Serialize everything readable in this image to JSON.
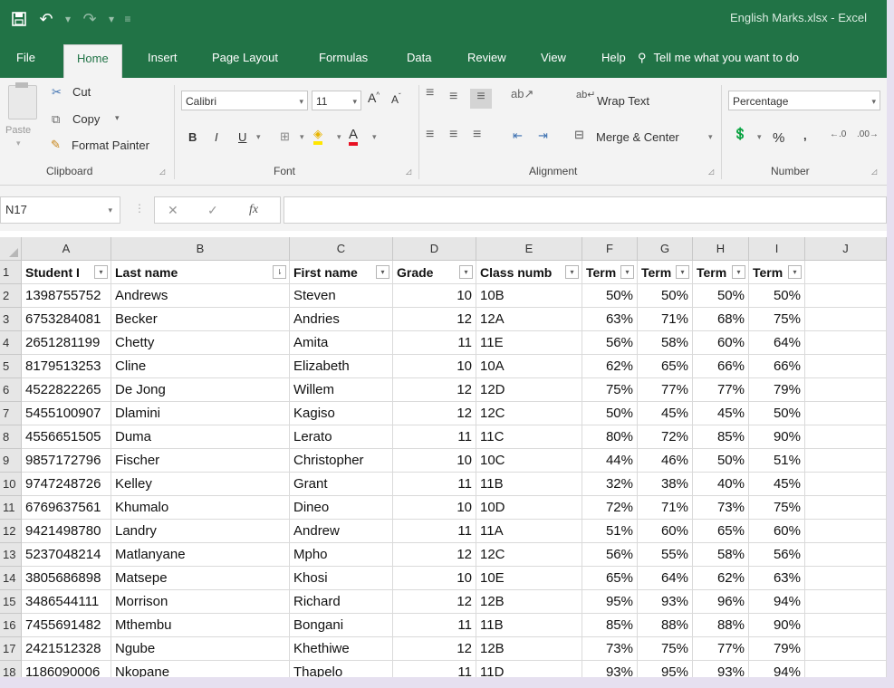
{
  "window": {
    "title": "English Marks.xlsx  -  Excel"
  },
  "qat": {
    "save_icon": "save-icon",
    "undo_icon": "undo-icon",
    "redo_icon": "redo-icon"
  },
  "tabs": [
    "File",
    "Home",
    "Insert",
    "Page Layout",
    "Formulas",
    "Data",
    "Review",
    "View",
    "Help"
  ],
  "tell_me": "Tell me what you want to do",
  "ribbon": {
    "clipboard": {
      "paste": "Paste",
      "cut": "Cut",
      "copy": "Copy",
      "format_painter": "Format Painter",
      "label": "Clipboard"
    },
    "font": {
      "name": "Calibri",
      "size": "11",
      "label": "Font"
    },
    "alignment": {
      "wrap_text": "Wrap Text",
      "merge_center": "Merge & Center",
      "label": "Alignment"
    },
    "number": {
      "format": "Percentage",
      "percent": "%",
      "comma": ",",
      "label": "Number"
    }
  },
  "formula_bar": {
    "name_box": "N17",
    "fx": "fx",
    "value": ""
  },
  "columns": [
    "A",
    "B",
    "C",
    "D",
    "E",
    "F",
    "G",
    "H",
    "I",
    "J"
  ],
  "header_row": [
    "Student I",
    "Last name",
    "First name",
    "Grade",
    "Class numb",
    "Term",
    "Term",
    "Term",
    "Term"
  ],
  "rows": [
    {
      "n": "2",
      "id": "1398755752",
      "last": "Andrews",
      "first": "Steven",
      "grade": "10",
      "cls": "10B",
      "t1": "50%",
      "t2": "50%",
      "t3": "50%",
      "t4": "50%"
    },
    {
      "n": "3",
      "id": "6753284081",
      "last": "Becker",
      "first": "Andries",
      "grade": "12",
      "cls": "12A",
      "t1": "63%",
      "t2": "71%",
      "t3": "68%",
      "t4": "75%"
    },
    {
      "n": "4",
      "id": "2651281199",
      "last": "Chetty",
      "first": "Amita",
      "grade": "11",
      "cls": "11E",
      "t1": "56%",
      "t2": "58%",
      "t3": "60%",
      "t4": "64%"
    },
    {
      "n": "5",
      "id": "8179513253",
      "last": "Cline",
      "first": "Elizabeth",
      "grade": "10",
      "cls": "10A",
      "t1": "62%",
      "t2": "65%",
      "t3": "66%",
      "t4": "66%"
    },
    {
      "n": "6",
      "id": "4522822265",
      "last": "De Jong",
      "first": "Willem",
      "grade": "12",
      "cls": "12D",
      "t1": "75%",
      "t2": "77%",
      "t3": "77%",
      "t4": "79%"
    },
    {
      "n": "7",
      "id": "5455100907",
      "last": "Dlamini",
      "first": "Kagiso",
      "grade": "12",
      "cls": "12C",
      "t1": "50%",
      "t2": "45%",
      "t3": "45%",
      "t4": "50%"
    },
    {
      "n": "8",
      "id": "4556651505",
      "last": "Duma",
      "first": "Lerato",
      "grade": "11",
      "cls": "11C",
      "t1": "80%",
      "t2": "72%",
      "t3": "85%",
      "t4": "90%"
    },
    {
      "n": "9",
      "id": "9857172796",
      "last": "Fischer",
      "first": "Christopher",
      "grade": "10",
      "cls": "10C",
      "t1": "44%",
      "t2": "46%",
      "t3": "50%",
      "t4": "51%"
    },
    {
      "n": "10",
      "id": "9747248726",
      "last": "Kelley",
      "first": "Grant",
      "grade": "11",
      "cls": "11B",
      "t1": "32%",
      "t2": "38%",
      "t3": "40%",
      "t4": "45%"
    },
    {
      "n": "11",
      "id": "6769637561",
      "last": "Khumalo",
      "first": "Dineo",
      "grade": "10",
      "cls": "10D",
      "t1": "72%",
      "t2": "71%",
      "t3": "73%",
      "t4": "75%"
    },
    {
      "n": "12",
      "id": "9421498780",
      "last": "Landry",
      "first": "Andrew",
      "grade": "11",
      "cls": "11A",
      "t1": "51%",
      "t2": "60%",
      "t3": "65%",
      "t4": "60%"
    },
    {
      "n": "13",
      "id": "5237048214",
      "last": "Matlanyane",
      "first": "Mpho",
      "grade": "12",
      "cls": "12C",
      "t1": "56%",
      "t2": "55%",
      "t3": "58%",
      "t4": "56%"
    },
    {
      "n": "14",
      "id": "3805686898",
      "last": "Matsepe",
      "first": "Khosi",
      "grade": "10",
      "cls": "10E",
      "t1": "65%",
      "t2": "64%",
      "t3": "62%",
      "t4": "63%"
    },
    {
      "n": "15",
      "id": "3486544111",
      "last": "Morrison",
      "first": "Richard",
      "grade": "12",
      "cls": "12B",
      "t1": "95%",
      "t2": "93%",
      "t3": "96%",
      "t4": "94%"
    },
    {
      "n": "16",
      "id": "7455691482",
      "last": "Mthembu",
      "first": "Bongani",
      "grade": "11",
      "cls": "11B",
      "t1": "85%",
      "t2": "88%",
      "t3": "88%",
      "t4": "90%"
    },
    {
      "n": "17",
      "id": "2421512328",
      "last": "Ngube",
      "first": "Khethiwe",
      "grade": "12",
      "cls": "12B",
      "t1": "73%",
      "t2": "75%",
      "t3": "77%",
      "t4": "79%"
    },
    {
      "n": "18",
      "id": "1186090006",
      "last": "Nkopane",
      "first": "Thapelo",
      "grade": "11",
      "cls": "11D",
      "t1": "93%",
      "t2": "95%",
      "t3": "93%",
      "t4": "94%"
    }
  ],
  "colors": {
    "excel_green": "#217346",
    "ribbon_bg": "#f3f3f3"
  }
}
